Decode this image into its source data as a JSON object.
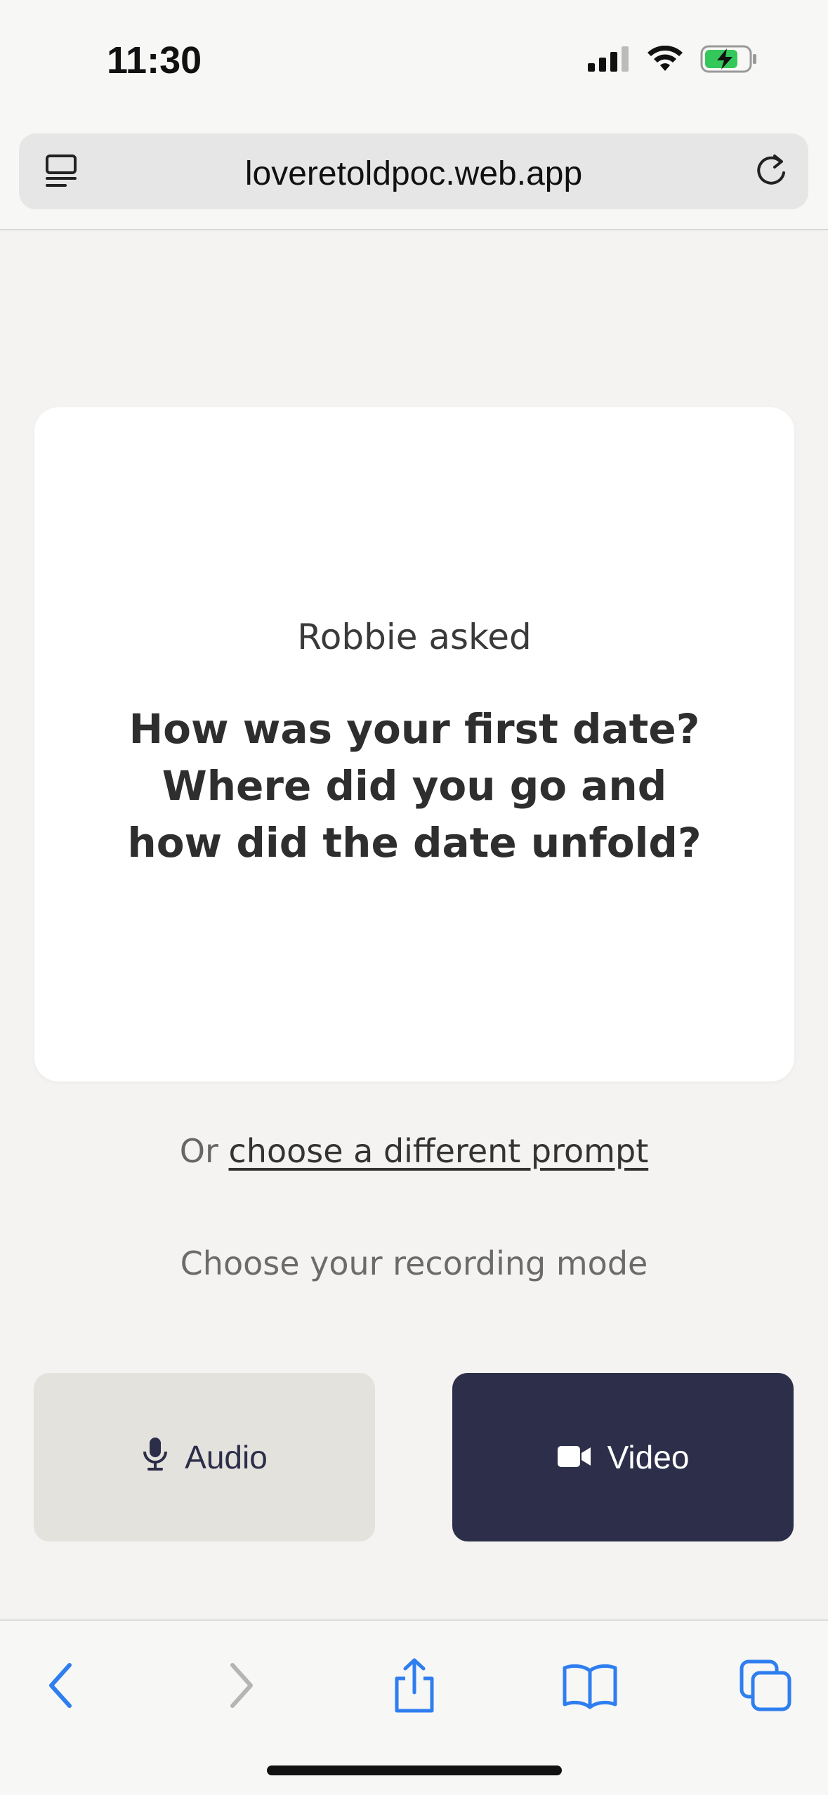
{
  "status_bar": {
    "time": "11:30"
  },
  "browser": {
    "url": "loveretoldpoc.web.app"
  },
  "prompt_card": {
    "asker": "Robbie asked",
    "question": "How was your first date? Where did you go and how did the date unfold?"
  },
  "alternate": {
    "prefix": "Or ",
    "link_label": "choose a different prompt"
  },
  "recording": {
    "label": "Choose your recording mode",
    "audio_label": "Audio",
    "video_label": "Video"
  },
  "colors": {
    "background": "#f4f3f1",
    "audio_button": "#e4e2dd",
    "video_button": "#2d2f4a",
    "toolbar_accent": "#2f7ef0"
  },
  "icons": {
    "status": [
      "signal-icon",
      "wifi-icon",
      "battery-charging-icon"
    ],
    "toolbar": [
      "back-icon",
      "forward-icon",
      "share-icon",
      "bookmarks-icon",
      "tabs-icon"
    ]
  }
}
